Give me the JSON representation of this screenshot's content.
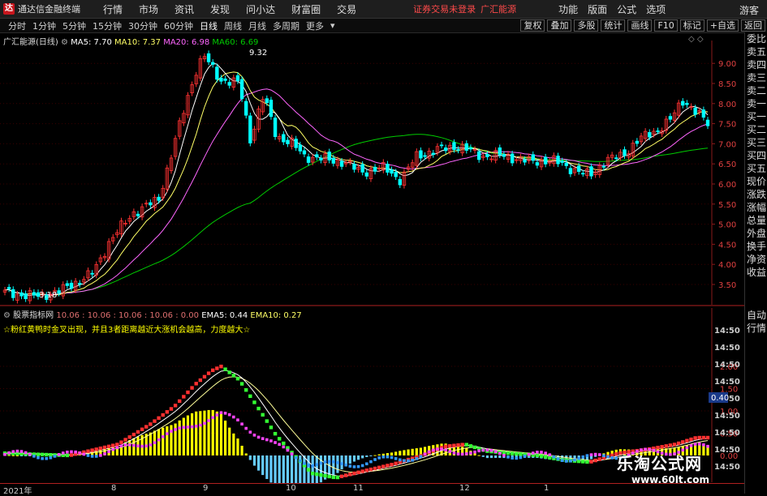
{
  "app": {
    "logo_glyph": "达",
    "title": "通达信金融终端",
    "menus": [
      "行情",
      "市场",
      "资讯",
      "发现",
      "问小达",
      "财富圈",
      "交易"
    ],
    "notice": "证券交易未登录",
    "notice_link": "广汇能源",
    "right_menus": [
      "功能",
      "版面",
      "公式",
      "选项"
    ],
    "guest": "游客"
  },
  "tabs": {
    "items": [
      "分时",
      "1分钟",
      "5分钟",
      "15分钟",
      "30分钟",
      "60分钟",
      "日线",
      "周线",
      "月线",
      "多周期",
      "更多"
    ],
    "active": "日线",
    "tools": [
      "复权",
      "叠加",
      "多股",
      "统计",
      "画线",
      "F10",
      "标记",
      "+自选",
      "返回"
    ]
  },
  "right_panel": {
    "items": [
      "委比",
      "卖五",
      "卖四",
      "卖三",
      "卖二",
      "卖一",
      "买一",
      "买二",
      "买三",
      "买四",
      "买五",
      "现价",
      "涨跌",
      "涨幅",
      "总量",
      "外盘",
      "换手",
      "净资",
      "收益",
      "自动",
      "行情"
    ]
  },
  "price_chart": {
    "stock_name": "广汇能源(日线)",
    "ma5_label": "MA5: 7.70",
    "ma10_label": "MA10: 7.37",
    "ma20_label": "MA20: 6.98",
    "ma60_label": "MA60: 6.69",
    "high_label": "9.32",
    "low_label": "3.18",
    "axis_labels": [
      "9.00",
      "8.50",
      "8.00",
      "7.50",
      "7.00",
      "6.50",
      "6.00",
      "5.50",
      "5.00",
      "4.50",
      "4.00",
      "3.50"
    ],
    "colors": {
      "up": "#ff3232",
      "down": "#00ffff",
      "ma5": "#ffffff",
      "ma10": "#ffff66",
      "ma20": "#ff66ff",
      "ma60": "#00cc00"
    }
  },
  "indicator": {
    "name": "股票指标网",
    "params": "10.06 : 10.06 : 10.06 : 10.06 : 0.00",
    "ema5_label": "EMA5: 0.44",
    "ema10_label": "EMA10: 0.27",
    "note": "☆粉红黄鸭时金叉出现，并且3者距离越近大涨机会越高，力度越大☆",
    "axis_labels": [
      "2.00",
      "1.50",
      "1.00",
      "0.50",
      "0.00"
    ],
    "time_labels": [
      "14:50",
      "14:50",
      "14:50",
      "14:50",
      "14:50",
      "14:50",
      "14:50",
      "14:50",
      "14:50"
    ],
    "current_value": "0.40"
  },
  "dates": [
    "2021年",
    "8",
    "9",
    "10",
    "11",
    "12",
    "1"
  ],
  "watermark": {
    "line1": "乐淘公式网",
    "line2": "www.60lt.com"
  },
  "chart_data": {
    "type": "line",
    "title": "广汇能源(日线)",
    "series": [
      {
        "name": "MA5",
        "values": [
          7.7
        ]
      },
      {
        "name": "MA10",
        "values": [
          7.37
        ]
      },
      {
        "name": "MA20",
        "values": [
          6.98
        ]
      },
      {
        "name": "MA60",
        "values": [
          6.69
        ]
      }
    ],
    "ylim": [
      3.1,
      9.5
    ],
    "annotations": [
      "9.32",
      "3.18"
    ]
  }
}
